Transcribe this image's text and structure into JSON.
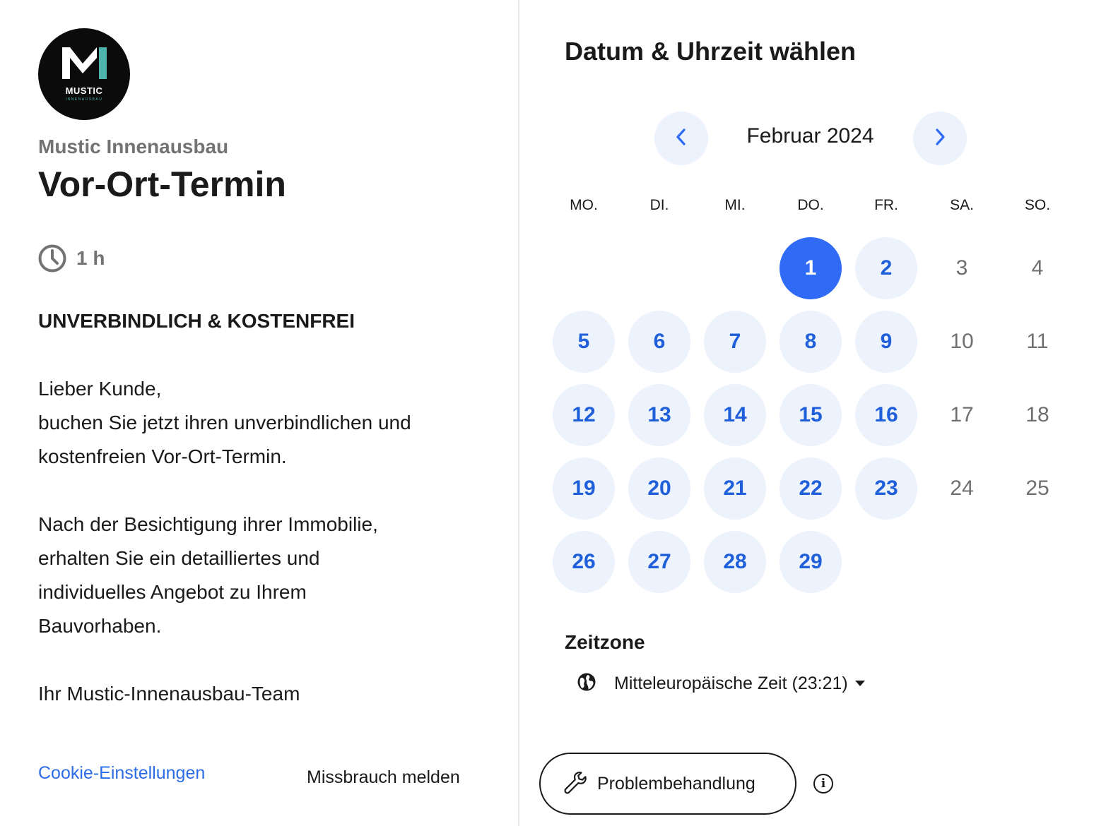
{
  "brand": {
    "logo_text": "MUSTIC",
    "logo_subtext": "INNENAUSBAU",
    "company": "Mustic Innenausbau"
  },
  "event": {
    "title": "Vor-Ort-Termin",
    "duration": "1 h",
    "heading": "UNVERBINDLICH & KOSTENFREI",
    "description_lines": [
      "Lieber Kunde,",
      "buchen Sie jetzt ihren unverbindlichen und",
      "kostenfreien Vor-Ort-Termin.",
      "Nach der Besichtigung ihrer Immobilie,",
      "erhalten Sie ein detailliertes und",
      "individuelles Angebot zu Ihrem",
      "Bauvorhaben.",
      "Ihr Mustic-Innenausbau-Team"
    ]
  },
  "footer": {
    "cookie_settings": "Cookie-Einstellungen",
    "report_abuse": "Missbrauch melden"
  },
  "calendar": {
    "title": "Datum & Uhrzeit wählen",
    "month_label": "Februar 2024",
    "weekdays": [
      "MO.",
      "DI.",
      "MI.",
      "DO.",
      "FR.",
      "SA.",
      "SO."
    ],
    "first_weekday_index": 3,
    "selected_day": 1,
    "days": [
      {
        "n": "1",
        "state": "selected"
      },
      {
        "n": "2",
        "state": "available"
      },
      {
        "n": "3",
        "state": "unavailable"
      },
      {
        "n": "4",
        "state": "unavailable"
      },
      {
        "n": "5",
        "state": "available"
      },
      {
        "n": "6",
        "state": "available"
      },
      {
        "n": "7",
        "state": "available"
      },
      {
        "n": "8",
        "state": "available"
      },
      {
        "n": "9",
        "state": "available"
      },
      {
        "n": "10",
        "state": "unavailable"
      },
      {
        "n": "11",
        "state": "unavailable"
      },
      {
        "n": "12",
        "state": "available"
      },
      {
        "n": "13",
        "state": "available"
      },
      {
        "n": "14",
        "state": "available"
      },
      {
        "n": "15",
        "state": "available"
      },
      {
        "n": "16",
        "state": "available"
      },
      {
        "n": "17",
        "state": "unavailable"
      },
      {
        "n": "18",
        "state": "unavailable"
      },
      {
        "n": "19",
        "state": "available"
      },
      {
        "n": "20",
        "state": "available"
      },
      {
        "n": "21",
        "state": "available"
      },
      {
        "n": "22",
        "state": "available"
      },
      {
        "n": "23",
        "state": "available"
      },
      {
        "n": "24",
        "state": "unavailable"
      },
      {
        "n": "25",
        "state": "unavailable"
      },
      {
        "n": "26",
        "state": "available"
      },
      {
        "n": "27",
        "state": "available"
      },
      {
        "n": "28",
        "state": "available"
      },
      {
        "n": "29",
        "state": "available"
      }
    ]
  },
  "timezone": {
    "label": "Zeitzone",
    "value": "Mitteleuropäische Zeit (23:21)"
  },
  "troubleshoot": {
    "label": "Problembehandlung"
  },
  "icons": {
    "duration": "clock-icon",
    "timezone": "globe-icon",
    "troubleshoot": "wrench-icon",
    "info": "info-icon",
    "prev_month": "chevron-left-icon",
    "next_month": "chevron-right-icon"
  },
  "colors": {
    "accent": "#2f6bf5",
    "available_bg": "#edf3fd",
    "available_text": "#1f5fd9",
    "link": "#2c6ce6",
    "muted": "#737373"
  }
}
